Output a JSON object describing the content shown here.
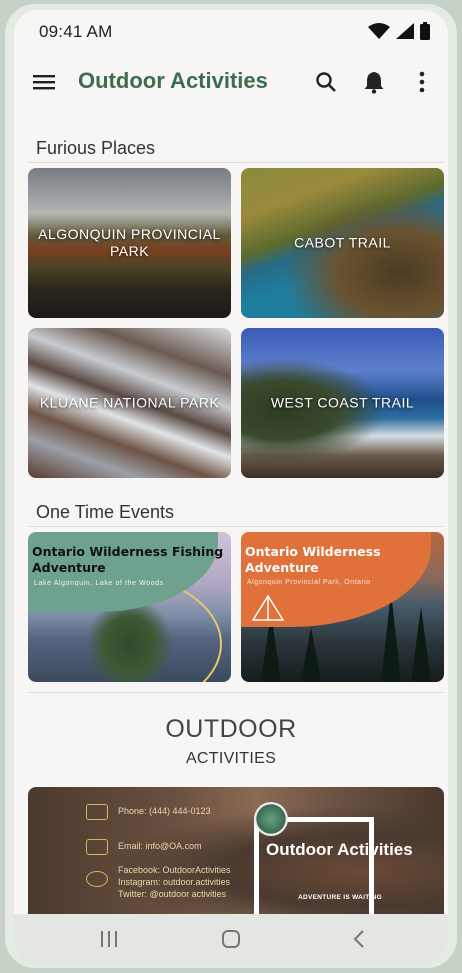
{
  "status_bar": {
    "time": "09:41 AM"
  },
  "app_bar": {
    "title": "Outdoor Activities"
  },
  "sections": {
    "places": {
      "title": "Furious Places",
      "cards": [
        {
          "label": "ALGONQUIN PROVINCIAL PARK"
        },
        {
          "label": "CABOT TRAIL"
        },
        {
          "label": "KLUANE NATIONAL PARK"
        },
        {
          "label": "WEST COAST TRAIL"
        }
      ]
    },
    "events": {
      "title": "One Time Events",
      "cards": [
        {
          "title": "Ontario Wilderness Fishing Adventure",
          "subtitle": "Lake Algonquin, Lake of the Woods"
        },
        {
          "title": "Ontario Wilderness Adventure",
          "subtitle": "Algonquin Provincial Park, Ontario"
        }
      ]
    }
  },
  "brand": {
    "title": "OUTDOOR",
    "subtitle": "ACTIVITIES"
  },
  "banner": {
    "phone": "Phone: (444) 444-0123",
    "email": "Email: info@OA.com",
    "social_1": "Facebook: OutdoorActivities",
    "social_2": "Instagram: outdoor.activities",
    "social_3": "Twitter: @outdoor activities",
    "title": "Outdoor Activities",
    "tagline": "ADVENTURE IS WAITING"
  },
  "colors": {
    "accent": "#3c6d50",
    "background": "#f8f6f4"
  }
}
